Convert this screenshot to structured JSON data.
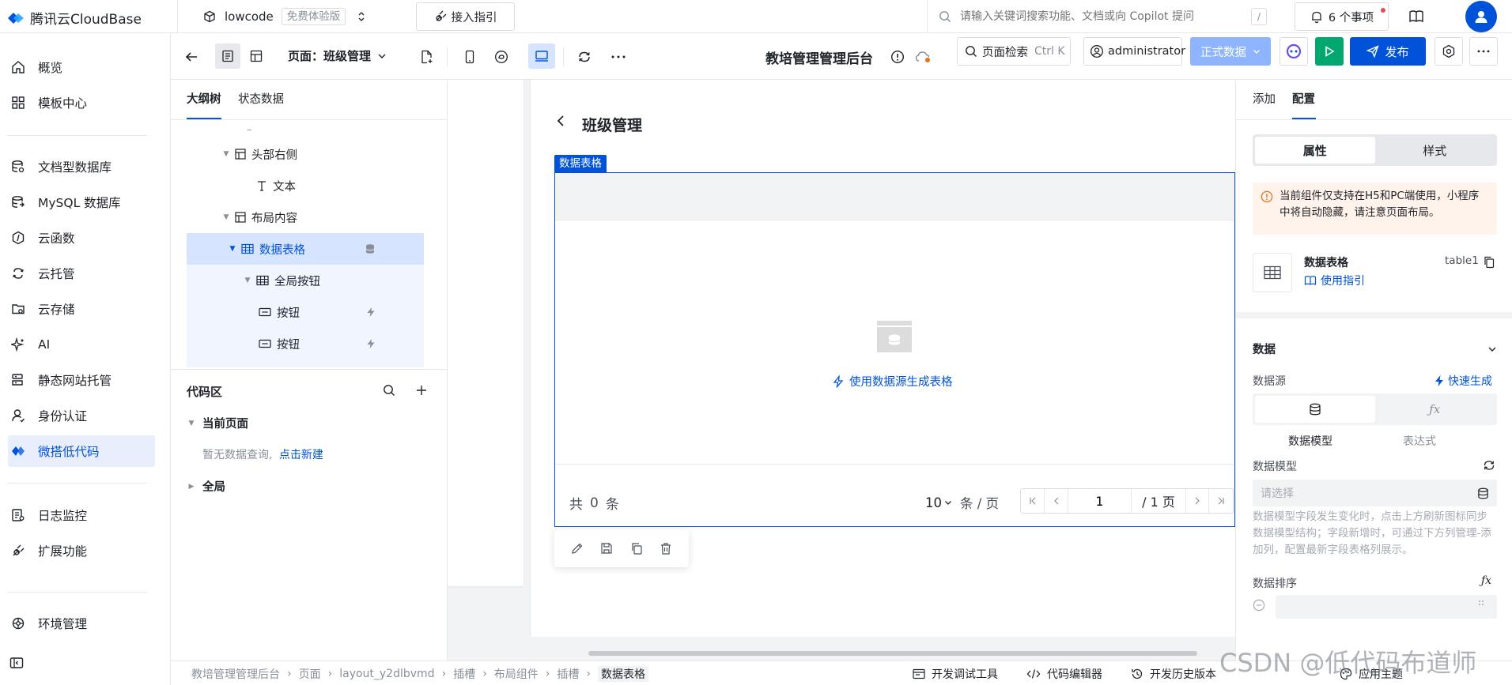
{
  "topbar": {
    "brand": "腾讯云CloudBase",
    "env_name": "lowcode",
    "env_badge": "免费体验版",
    "guide_label": "接入指引",
    "search_placeholder": "请输入关键词搜索功能、文档或向 Copilot 提问",
    "search_shortcut": "/",
    "notifications_label": "6 个事项"
  },
  "leftnav": {
    "items": [
      {
        "label": "概览",
        "icon": "home-icon"
      },
      {
        "label": "模板中心",
        "icon": "grid-icon"
      },
      {
        "label": "文档型数据库",
        "icon": "database-icon"
      },
      {
        "label": "MySQL 数据库",
        "icon": "mysql-icon"
      },
      {
        "label": "云函数",
        "icon": "function-icon"
      },
      {
        "label": "云托管",
        "icon": "cloud-hosting-icon"
      },
      {
        "label": "云存储",
        "icon": "storage-icon"
      },
      {
        "label": "AI",
        "icon": "sparkle-icon"
      },
      {
        "label": "静态网站托管",
        "icon": "website-icon"
      },
      {
        "label": "身份认证",
        "icon": "user-icon"
      },
      {
        "label": "微搭低代码",
        "icon": "lowcode-icon"
      },
      {
        "label": "日志监控",
        "icon": "log-icon"
      },
      {
        "label": "扩展功能",
        "icon": "extension-icon"
      },
      {
        "label": "环境管理",
        "icon": "environment-icon"
      }
    ]
  },
  "editor": {
    "page_label": "页面：班级管理",
    "app_title": "教培管理管理后台",
    "page_search_label": "页面检索",
    "page_search_shortcut": "Ctrl K",
    "user_label": "administrator",
    "data_mode_label": "正式数据",
    "publish_label": "发布"
  },
  "tree": {
    "tabs": [
      "大纲树",
      "状态数据"
    ],
    "rows": [
      {
        "label": "头部右侧",
        "type": "layout"
      },
      {
        "label": "文本",
        "type": "text"
      },
      {
        "label": "布局内容",
        "type": "layout"
      },
      {
        "label": "数据表格",
        "type": "table"
      },
      {
        "label": "全局按钮",
        "type": "table"
      },
      {
        "label": "按钮",
        "type": "button"
      },
      {
        "label": "按钮",
        "type": "button"
      }
    ],
    "code_area": {
      "title": "代码区",
      "current_page": "当前页面",
      "empty_text": "暂无数据查询,",
      "create_link": "点击新建",
      "global": "全局"
    }
  },
  "canvas": {
    "page_title": "班级管理",
    "component_tag": "数据表格",
    "generate_link": "使用数据源生成表格",
    "total_prefix": "共",
    "total_count": "0",
    "total_suffix": "条",
    "page_size": "10",
    "page_size_unit": "条 / 页",
    "current_page": "1",
    "total_pages": "/ 1 页"
  },
  "rightpanel": {
    "tabs": [
      "添加",
      "配置"
    ],
    "segments": [
      "属性",
      "样式"
    ],
    "alert": "当前组件仅支持在H5和PC端使用，小程序中将自动隐藏，请注意页面布局。",
    "component_name": "数据表格",
    "component_id": "table1",
    "usage_guide": "使用指引",
    "section_data": "数据",
    "datasource_label": "数据源",
    "quick_generate": "快速生成",
    "source_options": [
      "数据模型",
      "表达式"
    ],
    "model_label": "数据模型",
    "model_placeholder": "请选择",
    "model_help": "数据模型字段发生变化时，点击上方刷新图标同步数据模型结构；字段新增时，可通过下方列管理-添加列，配置最新字段表格列展示。",
    "sort_label": "数据排序"
  },
  "statusbar": {
    "breadcrumb": [
      "教培管理管理后台",
      "页面",
      "layout_y2dlbvmd",
      "插槽",
      "布局组件",
      "插槽",
      "数据表格"
    ],
    "dev_tools": "开发调试工具",
    "code_editor": "代码编辑器",
    "history": "开发历史版本",
    "theme": "应用主题"
  },
  "watermark": "CSDN @低代码布道师",
  "colors": {
    "accent": "#0052d9",
    "selected_bg": "#d6e4ff",
    "run_green": "#00a870",
    "alert_bg": "#fff3ec",
    "alert_orange": "#e37318"
  }
}
